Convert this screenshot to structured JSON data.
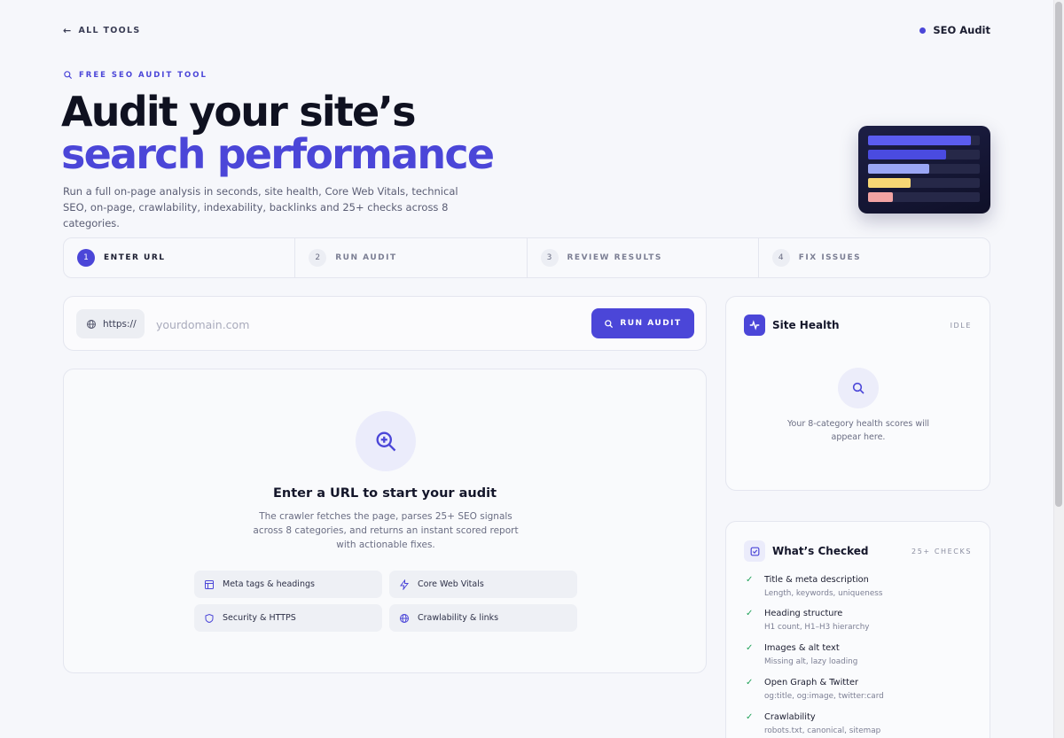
{
  "nav": {
    "back_label": "ALL TOOLS",
    "badge_label": "SEO Audit"
  },
  "hero": {
    "eyebrow": "FREE SEO AUDIT TOOL",
    "title_line1": "Audit your site’s",
    "title_line2": "search performance",
    "subtitle": "Run a full on-page analysis in seconds, site health, Core Web Vitals, technical SEO, on-page, crawlability, indexability, backlinks and 25+ checks across 8 categories."
  },
  "hero_art_bars": [
    {
      "color": "#5b5cf0",
      "fill": 0.92
    },
    {
      "color": "#4a4be0",
      "fill": 0.7
    },
    {
      "color": "#9aa6f5",
      "fill": 0.55
    },
    {
      "color": "#f7d774",
      "fill": 0.38
    },
    {
      "color": "#f2a3a3",
      "fill": 0.22
    }
  ],
  "steps": [
    {
      "num": "1",
      "label": "ENTER URL",
      "active": true
    },
    {
      "num": "2",
      "label": "RUN AUDIT",
      "active": false
    },
    {
      "num": "3",
      "label": "REVIEW RESULTS",
      "active": false
    },
    {
      "num": "4",
      "label": "FIX ISSUES",
      "active": false
    }
  ],
  "url_bar": {
    "protocol": "https://",
    "placeholder": "yourdomain.com",
    "button_label": "RUN AUDIT"
  },
  "empty_state": {
    "title": "Enter a URL to start your audit",
    "description": "The crawler fetches the page, parses 25+ SEO signals across 8 categories, and returns an instant scored report with actionable fixes.",
    "chips": [
      {
        "label": "Meta tags & headings",
        "icon": "layout-icon"
      },
      {
        "label": "Core Web Vitals",
        "icon": "lightning-icon"
      },
      {
        "label": "Security & HTTPS",
        "icon": "shield-icon"
      },
      {
        "label": "Crawlability & links",
        "icon": "globe-icon"
      }
    ]
  },
  "site_health": {
    "title": "Site Health",
    "status": "IDLE",
    "note": "Your 8-category health scores will appear here."
  },
  "whats_checked": {
    "title": "What’s Checked",
    "count": "25+ CHECKS",
    "items": [
      {
        "title": "Title & meta description",
        "desc": "Length, keywords, uniqueness"
      },
      {
        "title": "Heading structure",
        "desc": "H1 count, H1–H3 hierarchy"
      },
      {
        "title": "Images & alt text",
        "desc": "Missing alt, lazy loading"
      },
      {
        "title": "Open Graph & Twitter",
        "desc": "og:title, og:image, twitter:card"
      },
      {
        "title": "Crawlability",
        "desc": "robots.txt, canonical, sitemap"
      }
    ]
  },
  "colors": {
    "accent": "#4b46d8",
    "check": "#22a35a"
  }
}
